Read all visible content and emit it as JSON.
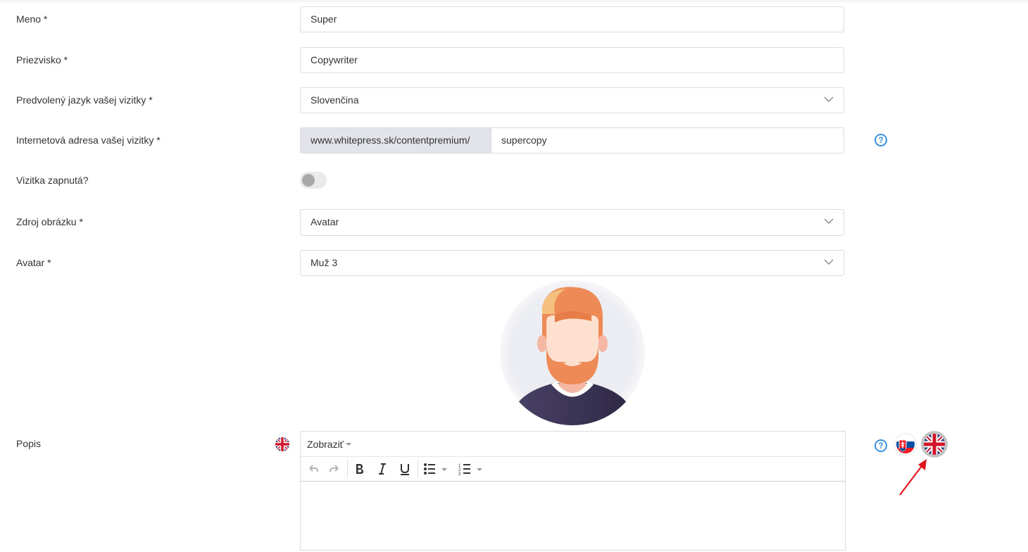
{
  "form": {
    "first_name": {
      "label": "Meno *",
      "value": "Super"
    },
    "last_name": {
      "label": "Priezvisko *",
      "value": "Copywriter"
    },
    "language": {
      "label": "Predvolený jazyk vašej vizitky *",
      "value": "Slovenčina"
    },
    "url": {
      "label": "Internetová adresa vašej vizitky *",
      "prefix": "www.whitepress.sk/contentpremium/",
      "value": "supercopy"
    },
    "enabled": {
      "label": "Vizitka zapnutá?",
      "on": false
    },
    "image_source": {
      "label": "Zdroj obrázku *",
      "value": "Avatar"
    },
    "avatar": {
      "label": "Avatar *",
      "value": "Muž 3"
    },
    "description": {
      "label": "Popis",
      "menu_label": "Zobraziť",
      "toolbar": [
        "undo-icon",
        "redo-icon",
        "bold-icon",
        "italic-icon",
        "underline-icon",
        "bullet-list-icon",
        "numbered-list-icon"
      ],
      "content": ""
    }
  },
  "help_symbol": "?",
  "colors": {
    "accent": "#3a8fe0",
    "arrow": "#e0161f"
  }
}
